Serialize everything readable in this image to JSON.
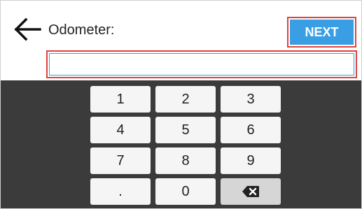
{
  "header": {
    "back_icon": "arrow-left-icon",
    "title": "Odometer:",
    "next_label": "NEXT",
    "accent_color": "#3a9ee4",
    "highlight_color": "#e0433b"
  },
  "input": {
    "value": "",
    "placeholder": ""
  },
  "keypad": {
    "keys": [
      "1",
      "2",
      "3",
      "4",
      "5",
      "6",
      "7",
      "8",
      "9",
      ".",
      "0"
    ],
    "backspace_icon": "backspace-icon"
  }
}
